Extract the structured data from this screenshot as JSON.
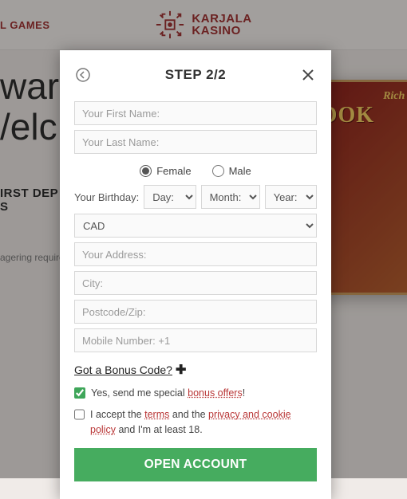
{
  "brand": {
    "line1": "KARJALA",
    "line2": "KASINO"
  },
  "nav": {
    "games": "L GAMES"
  },
  "hero": {
    "title_l1": "war",
    "title_l2": "/elc",
    "sub_l1": "IRST DEP",
    "sub_l2": "S",
    "note": "agering require",
    "game_t1": "Rich W",
    "game_t2": "BOOK"
  },
  "modal": {
    "title": "STEP 2/2",
    "first_name_ph": "Your First Name:",
    "last_name_ph": "Your Last Name:",
    "gender_female": "Female",
    "gender_male": "Male",
    "bday_label": "Your Birthday:",
    "day": "Day:",
    "month": "Month:",
    "year": "Year:",
    "currency": "CAD",
    "address_ph": "Your Address:",
    "city_ph": "City:",
    "postcode_ph": "Postcode/Zip:",
    "mobile_ph": "Mobile Number: +1",
    "bonus_link": "Got a Bonus Code?",
    "offers_pre": "Yes, send me special ",
    "offers_link": "bonus offers",
    "offers_post": "!",
    "terms_pre": "I accept the ",
    "terms_link": "terms",
    "terms_mid": " and the ",
    "privacy_link": "privacy and cookie policy",
    "terms_post": " and I'm at least 18.",
    "open_btn": "OPEN ACCOUNT"
  }
}
